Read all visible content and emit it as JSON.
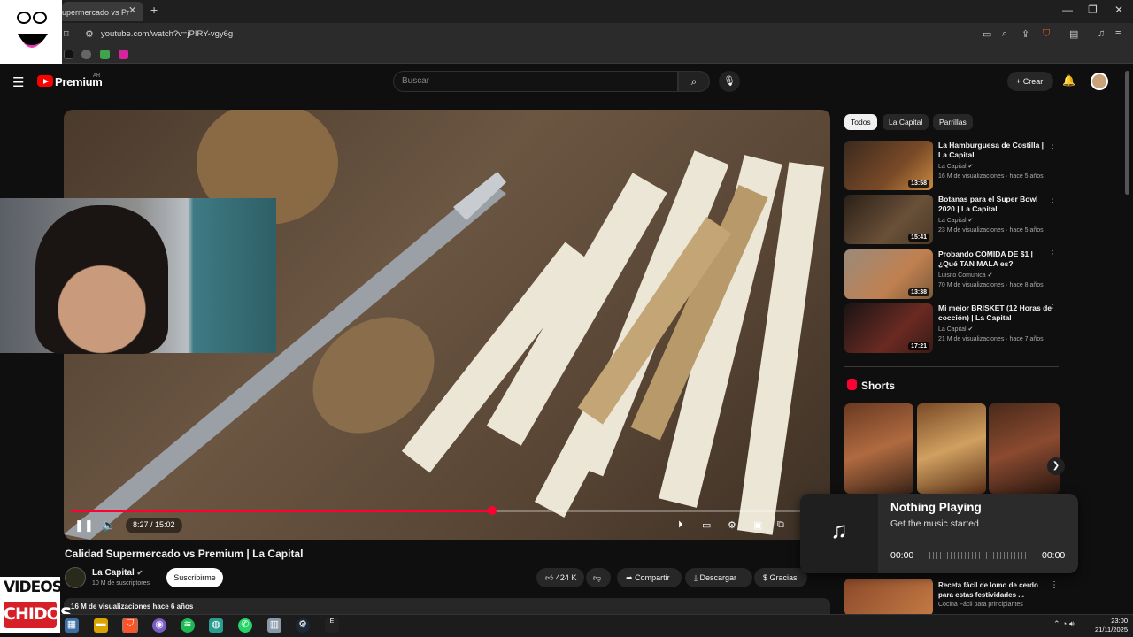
{
  "browser": {
    "tab_title": "upermercado vs Pr",
    "url": "youtube.com/watch?v=jPIRY-vgy6g"
  },
  "header": {
    "logo_text": "Premium",
    "logo_sup": "AR",
    "search_placeholder": "Buscar",
    "create_label": "Crear"
  },
  "player": {
    "time": "8:27 / 15:02",
    "progress": 0.56
  },
  "video": {
    "title": "Calidad Supermercado vs Premium | La Capital",
    "channel": "La Capital",
    "subscribers": "10 M de suscriptores",
    "subscribe_label": "Suscribirme",
    "likes": "424 K",
    "share_label": "Compartir",
    "download_label": "Descargar",
    "thanks_label": "Gracias",
    "views_line": "16 M de visualizaciones  hace 6 años"
  },
  "sidebar": {
    "chips": [
      "Todos",
      "La Capital",
      "Parrillas"
    ],
    "recommendations": [
      {
        "title": "La Hamburguesa de Costilla | La Capital",
        "channel": "La Capital",
        "meta": "16 M de visualizaciones · hace 5 años",
        "duration": "13:58",
        "color": "#5a3a22"
      },
      {
        "title": "Botanas para el Super Bowl 2020 | La Capital",
        "channel": "La Capital",
        "meta": "23 M de visualizaciones · hace 5 años",
        "duration": "15:41",
        "color": "#4a3a2a"
      },
      {
        "title": "Probando COMIDA DE $1 | ¿Qué TAN MALA es?",
        "channel": "Luisito Comunica",
        "meta": "70 M de visualizaciones · hace 8 años",
        "duration": "13:38",
        "color": "#8a6a4a"
      },
      {
        "title": "Mi mejor BRISKET (12 Horas de cocción) | La Capital",
        "channel": "La Capital",
        "meta": "21 M de visualizaciones · hace 7 años",
        "duration": "17:21",
        "color": "#3a2222"
      }
    ],
    "shorts_title": "Shorts",
    "bottom_rec": {
      "title": "Receta fácil de lomo de cerdo para estas festividades ...",
      "channel": "Cocina Fácil para principiantes"
    }
  },
  "music_widget": {
    "title": "Nothing Playing",
    "subtitle": "Get the music started",
    "time_start": "00:00",
    "time_end": "00:00"
  },
  "overlay": {
    "logo_line1": "VIDEOS",
    "logo_line2": "CHIDOS"
  },
  "taskbar": {
    "time": "23:00",
    "date": "21/11/2025"
  }
}
